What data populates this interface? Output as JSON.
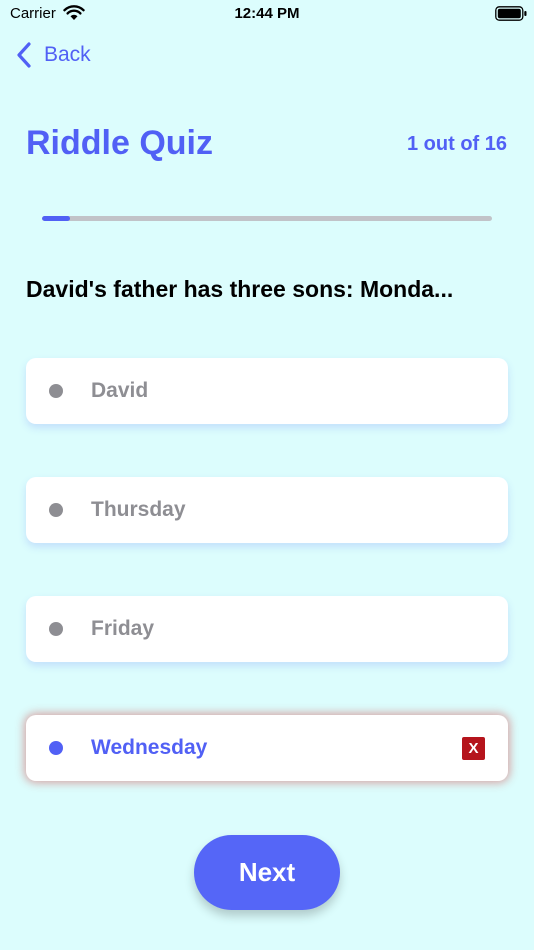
{
  "status_bar": {
    "carrier": "Carrier",
    "time": "12:44 PM"
  },
  "nav": {
    "back_label": "Back"
  },
  "quiz": {
    "title": "Riddle Quiz",
    "progress_text": "1 out of 16",
    "progress_fraction": 0.0625,
    "question": "David's father has three sons: Monda...",
    "options": [
      {
        "label": "David"
      },
      {
        "label": "Thursday"
      },
      {
        "label": "Friday"
      },
      {
        "label": "Wednesday",
        "selected": true,
        "wrong_mark": "X"
      }
    ],
    "next_label": "Next"
  },
  "colors": {
    "background": "#dcfdfd",
    "accent": "#5160f5",
    "muted": "#8e8e93",
    "wrong": "#b5141c"
  }
}
